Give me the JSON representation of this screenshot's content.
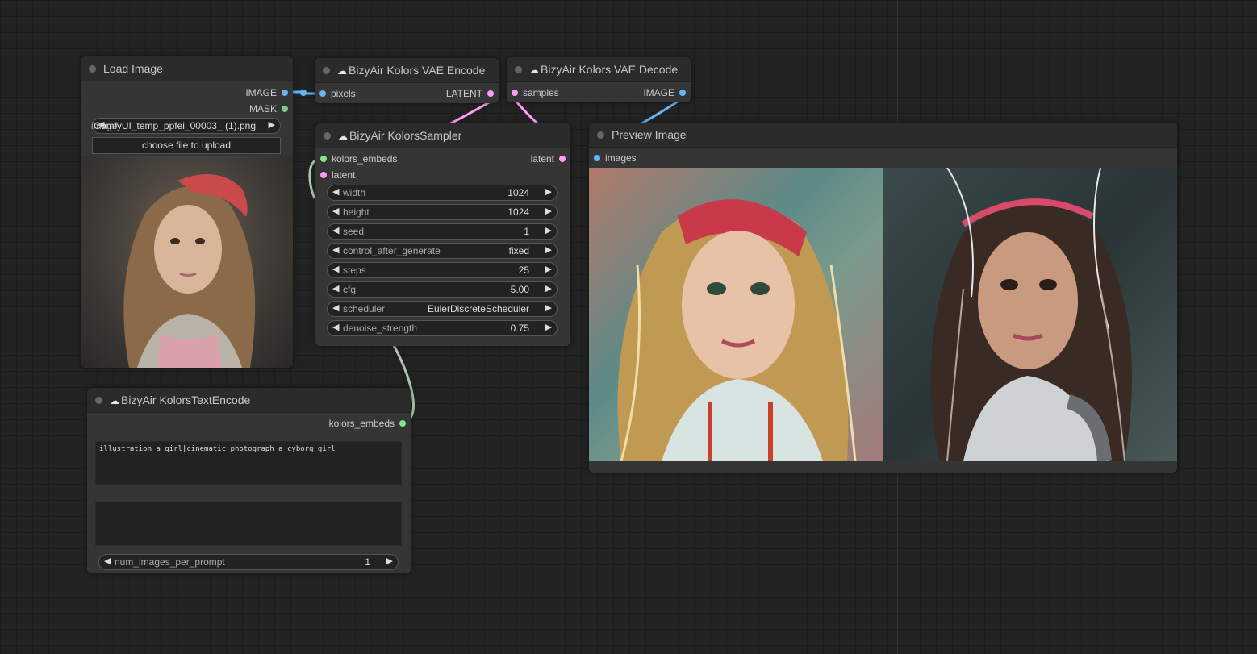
{
  "load_image": {
    "title": "Load Image",
    "outputs": [
      "IMAGE",
      "MASK"
    ],
    "file_label": "image",
    "file_value": "ComfyUI_temp_ppfei_00003_ (1).png",
    "upload_button": "choose file to upload"
  },
  "vae_encode": {
    "title": "BizyAir Kolors VAE Encode",
    "input": "pixels",
    "output": "LATENT"
  },
  "vae_decode": {
    "title": "BizyAir Kolors VAE Decode",
    "input": "samples",
    "output": "IMAGE"
  },
  "sampler": {
    "title": "BizyAir KolorsSampler",
    "inputs": [
      "kolors_embeds",
      "latent"
    ],
    "output": "latent",
    "widgets": [
      {
        "label": "width",
        "value": "1024"
      },
      {
        "label": "height",
        "value": "1024"
      },
      {
        "label": "seed",
        "value": "1"
      },
      {
        "label": "control_after_generate",
        "value": "fixed"
      },
      {
        "label": "steps",
        "value": "25"
      },
      {
        "label": "cfg",
        "value": "5.00"
      },
      {
        "label": "scheduler",
        "value": "EulerDiscreteScheduler"
      },
      {
        "label": "denoise_strength",
        "value": "0.75"
      }
    ]
  },
  "preview": {
    "title": "Preview Image",
    "input": "images"
  },
  "text_encode": {
    "title": "BizyAir KolorsTextEncode",
    "output": "kolors_embeds",
    "prompt": "illustration a girl|cinematic photograph a cyborg girl",
    "negative": "",
    "widget": {
      "label": "num_images_per_prompt",
      "value": "1"
    }
  },
  "colors": {
    "image_slot": "#64b5f6",
    "latent_slot": "#ff9cf9",
    "embeds_slot": "#7ee787",
    "mask_slot": "#81c784",
    "wire_latent": "#ff9cf9",
    "wire_image": "#64b5f6",
    "wire_embeds": "#b0c4b0"
  },
  "icons": {
    "collapse": "circle-dot-icon",
    "cloud": "cloud-icon",
    "arrow_left": "triangle-left-icon",
    "arrow_right": "triangle-right-icon"
  }
}
